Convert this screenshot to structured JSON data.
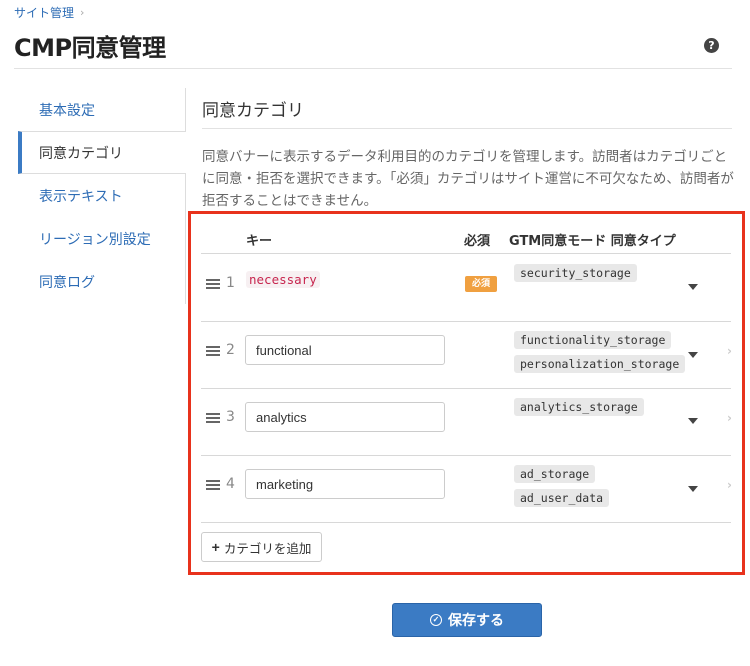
{
  "breadcrumb": {
    "items": [
      "サイト管理"
    ],
    "separator": "›"
  },
  "page_title": "CMP同意管理",
  "help_icon": "?",
  "sidebar": {
    "items": [
      {
        "label": "基本設定",
        "active": false
      },
      {
        "label": "同意カテゴリ",
        "active": true
      },
      {
        "label": "表示テキスト",
        "active": false
      },
      {
        "label": "リージョン別設定",
        "active": false
      },
      {
        "label": "同意ログ",
        "active": false
      }
    ]
  },
  "section": {
    "title": "同意カテゴリ",
    "description": "同意バナーに表示するデータ利用目的のカテゴリを管理します。訪問者はカテゴリごとに同意・拒否を選択できます。「必須」カテゴリはサイト運営に不可欠なため、訪問者が拒否することはできません。"
  },
  "table": {
    "headers": {
      "key": "キー",
      "required": "必須",
      "gtm": "GTM同意モード 同意タイプ"
    },
    "rows": [
      {
        "num": "1",
        "key": "necessary",
        "editable": false,
        "required_label": "必須",
        "gtm_types": [
          "security_storage"
        ]
      },
      {
        "num": "2",
        "key": "functional",
        "editable": true,
        "required_label": "",
        "gtm_types": [
          "functionality_storage",
          "personalization_storage"
        ]
      },
      {
        "num": "3",
        "key": "analytics",
        "editable": true,
        "required_label": "",
        "gtm_types": [
          "analytics_storage"
        ]
      },
      {
        "num": "4",
        "key": "marketing",
        "editable": true,
        "required_label": "",
        "gtm_types": [
          "ad_storage",
          "ad_user_data"
        ]
      }
    ]
  },
  "add_button_label": "カテゴリを追加",
  "save_button_label": "保存する",
  "colors": {
    "accent": "#3b7bc4",
    "highlight": "#e8321c",
    "badge": "#f0a040",
    "code": "#c7254e"
  }
}
